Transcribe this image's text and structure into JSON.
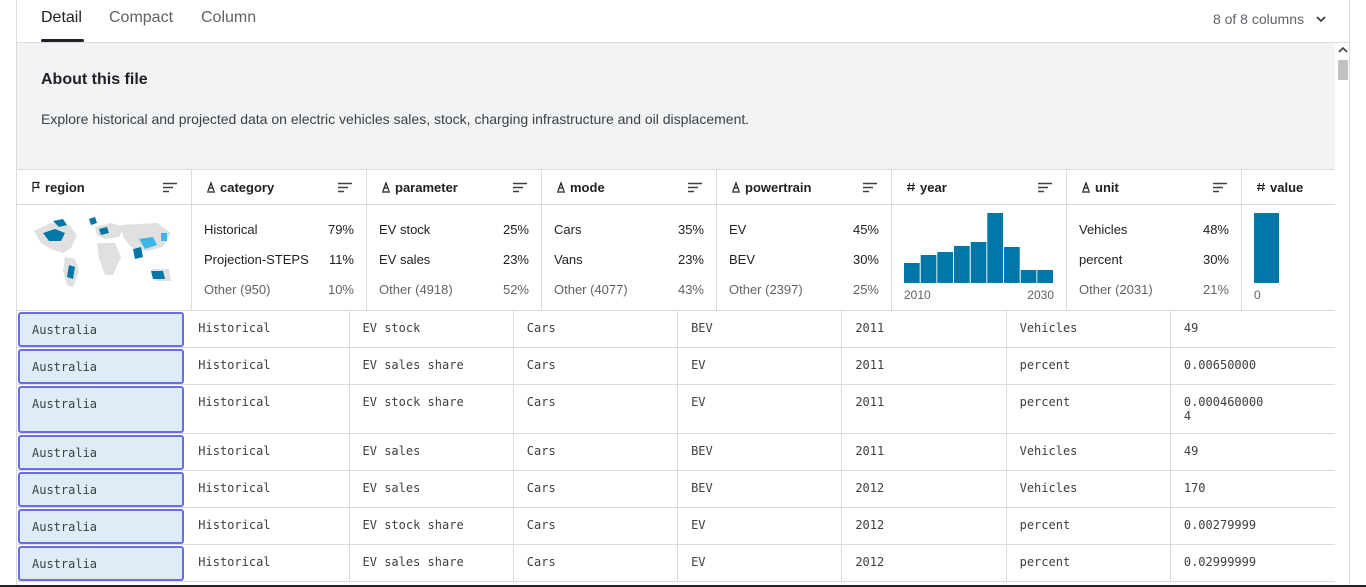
{
  "tabs": [
    {
      "label": "Detail",
      "active": true
    },
    {
      "label": "Compact",
      "active": false
    },
    {
      "label": "Column",
      "active": false
    }
  ],
  "column_count": "8 of 8 columns",
  "about": {
    "title": "About this file",
    "description": "Explore historical and projected data on electric vehicles sales, stock, charging infrastructure and oil displacement."
  },
  "columns": [
    {
      "name": "region",
      "type_icon": "flag-icon"
    },
    {
      "name": "category",
      "type_icon": "string-icon"
    },
    {
      "name": "parameter",
      "type_icon": "string-icon"
    },
    {
      "name": "mode",
      "type_icon": "string-icon"
    },
    {
      "name": "powertrain",
      "type_icon": "string-icon"
    },
    {
      "name": "year",
      "type_icon": "hash-icon"
    },
    {
      "name": "unit",
      "type_icon": "string-icon"
    },
    {
      "name": "value",
      "type_icon": "hash-icon"
    }
  ],
  "summaries": {
    "category": [
      {
        "label": "Historical",
        "pct": "79%"
      },
      {
        "label": "Projection-STEPS",
        "pct": "11%"
      },
      {
        "label": "Other (950)",
        "pct": "10%"
      }
    ],
    "parameter": [
      {
        "label": "EV stock",
        "pct": "25%"
      },
      {
        "label": "EV sales",
        "pct": "23%"
      },
      {
        "label": "Other (4918)",
        "pct": "52%"
      }
    ],
    "mode": [
      {
        "label": "Cars",
        "pct": "35%"
      },
      {
        "label": "Vans",
        "pct": "23%"
      },
      {
        "label": "Other (4077)",
        "pct": "43%"
      }
    ],
    "powertrain": [
      {
        "label": "EV",
        "pct": "45%"
      },
      {
        "label": "BEV",
        "pct": "30%"
      },
      {
        "label": "Other (2397)",
        "pct": "25%"
      }
    ],
    "unit": [
      {
        "label": "Vehicles",
        "pct": "48%"
      },
      {
        "label": "percent",
        "pct": "30%"
      },
      {
        "label": "Other (2031)",
        "pct": "21%"
      }
    ],
    "year_hist": {
      "min": "2010",
      "max": "2030",
      "bars": [
        0.29,
        0.4,
        0.44,
        0.53,
        0.59,
        1.0,
        0.51,
        0.18,
        0.18
      ]
    },
    "value_hist": {
      "min": "0",
      "bars": [
        1.0
      ]
    }
  },
  "accent_color": "#0077a6",
  "selection_color": "#6b6de6",
  "rows": [
    {
      "region": "Australia",
      "category": "Historical",
      "parameter": "EV stock",
      "mode": "Cars",
      "powertrain": "BEV",
      "year": "2011",
      "unit": "Vehicles",
      "value": "49"
    },
    {
      "region": "Australia",
      "category": "Historical",
      "parameter": "EV sales share",
      "mode": "Cars",
      "powertrain": "EV",
      "year": "2011",
      "unit": "percent",
      "value": "0.00650000"
    },
    {
      "region": "Australia",
      "category": "Historical",
      "parameter": "EV stock share",
      "mode": "Cars",
      "powertrain": "EV",
      "year": "2011",
      "unit": "percent",
      "value": "0.000460000\n4"
    },
    {
      "region": "Australia",
      "category": "Historical",
      "parameter": "EV sales",
      "mode": "Cars",
      "powertrain": "BEV",
      "year": "2011",
      "unit": "Vehicles",
      "value": "49"
    },
    {
      "region": "Australia",
      "category": "Historical",
      "parameter": "EV sales",
      "mode": "Cars",
      "powertrain": "BEV",
      "year": "2012",
      "unit": "Vehicles",
      "value": "170"
    },
    {
      "region": "Australia",
      "category": "Historical",
      "parameter": "EV stock share",
      "mode": "Cars",
      "powertrain": "EV",
      "year": "2012",
      "unit": "percent",
      "value": "0.00279999"
    },
    {
      "region": "Australia",
      "category": "Historical",
      "parameter": "EV sales share",
      "mode": "Cars",
      "powertrain": "EV",
      "year": "2012",
      "unit": "percent",
      "value": "0.02999999"
    }
  ]
}
